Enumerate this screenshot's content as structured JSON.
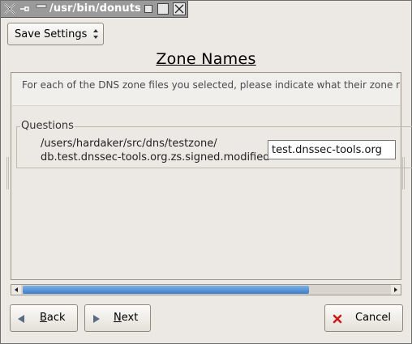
{
  "window": {
    "title": "/usr/bin/donuts"
  },
  "toolbar": {
    "save_settings_label": "Save Settings"
  },
  "page": {
    "heading": "Zone Names",
    "description": "For each of the DNS zone files you selected, please indicate what their zone names are."
  },
  "questions": {
    "legend": "Questions",
    "items": [
      {
        "path_line1": "/users/hardaker/src/dns/testzone/",
        "path_line2": "db.test.dnssec-tools.org.zs.signed.modified",
        "zone_value": "test.dnssec-tools.org"
      }
    ]
  },
  "scrollbar": {
    "position_fraction": 0.78
  },
  "buttons": {
    "back_mnemonic": "B",
    "back_rest": "ack",
    "next_mnemonic": "N",
    "next_rest": "ext",
    "cancel_label": "Cancel"
  },
  "colors": {
    "titlebar": "#9a9a9a",
    "scroll_thumb": "#3c7fc8",
    "cancel_icon": "#cc1a1a"
  },
  "icons": {
    "window_menu": "x-icon",
    "pin": "pin-icon",
    "shade": "shade-icon",
    "minimize": "minimize-icon",
    "maximize": "maximize-icon",
    "close": "close-icon",
    "back": "triangle-left-icon",
    "next": "triangle-right-icon",
    "cancel": "red-x-icon"
  }
}
